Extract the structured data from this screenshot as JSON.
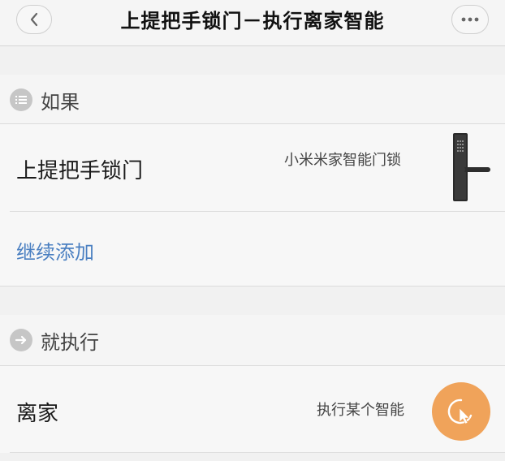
{
  "header": {
    "title": "上提把手锁门－执行离家智能",
    "back_icon": "chevron-left-icon",
    "more_icon": "more-dots-icon"
  },
  "if_section": {
    "label": "如果",
    "icon": "list-icon",
    "condition": {
      "name": "上提把手锁门",
      "device": "小米米家智能门锁",
      "device_image": "smart-door-lock-image"
    },
    "add_more": "继续添加"
  },
  "then_section": {
    "label": "就执行",
    "icon": "arrow-right-icon",
    "action": {
      "name": "离家",
      "type": "执行某个智能",
      "icon": "tap-gesture-icon",
      "color": "#f0a35a"
    }
  }
}
